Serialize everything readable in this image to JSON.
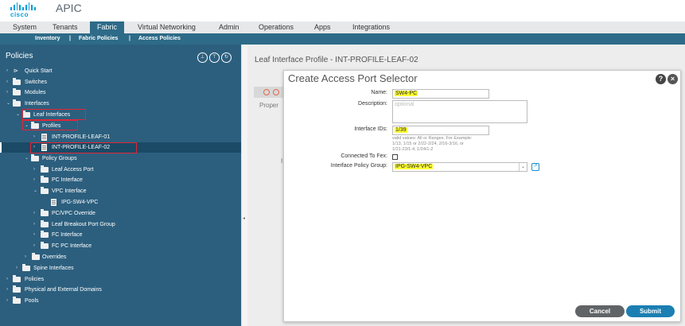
{
  "header": {
    "brand": "cisco",
    "app_title": "APIC"
  },
  "nav": {
    "tabs": [
      "System",
      "Tenants",
      "Fabric",
      "Virtual Networking",
      "Admin",
      "Operations",
      "Apps",
      "Integrations"
    ],
    "active_tab": "Fabric",
    "subtabs": [
      "Inventory",
      "|",
      "Fabric Policies",
      "|",
      "Access Policies"
    ]
  },
  "sidebar": {
    "title": "Policies",
    "tree": [
      {
        "label": "Quick Start"
      },
      {
        "label": "Switches"
      },
      {
        "label": "Modules"
      },
      {
        "label": "Interfaces"
      },
      {
        "label": "Leaf Interfaces"
      },
      {
        "label": "Profiles"
      },
      {
        "label": "INT-PROFILE-LEAF-01"
      },
      {
        "label": "INT-PROFILE-LEAF-02"
      },
      {
        "label": "Policy Groups"
      },
      {
        "label": "Leaf Access Port"
      },
      {
        "label": "PC Interface"
      },
      {
        "label": "VPC Interface"
      },
      {
        "label": "IPG-SW4-VPC"
      },
      {
        "label": "PC/VPC Override"
      },
      {
        "label": "Leaf Breakout Port Group"
      },
      {
        "label": "FC Interface"
      },
      {
        "label": "FC PC Interface"
      },
      {
        "label": "Overrides"
      },
      {
        "label": "Spine Interfaces"
      },
      {
        "label": "Policies"
      },
      {
        "label": "Physical and External Domains"
      },
      {
        "label": "Pools"
      }
    ]
  },
  "main": {
    "title": "Leaf Interface Profile - INT-PROFILE-LEAF-02",
    "ghost_prop": "Proper",
    "ghost_i": "I"
  },
  "dialog": {
    "title": "Create Access Port Selector",
    "help": "?",
    "close": "×",
    "name_label": "Name:",
    "name_value": "SW4-PC",
    "description_label": "Description:",
    "description_placeholder": "optional",
    "interface_ids_label": "Interface IDs:",
    "interface_ids_value": "1/39",
    "hint_line1": "valid values: All or Ranges. For Example:",
    "hint_line2": "1/13, 1/15 or 2/22-2/24, 2/16-3/16, or",
    "hint_line3": "1/21-23/1-4, 1/24/1-2",
    "fex_label": "Connected To Fex:",
    "fex_checked": false,
    "policy_group_label": "Interface Policy Group:",
    "policy_group_value": "IPG-SW4-VPC",
    "cancel_label": "Cancel",
    "submit_label": "Submit"
  },
  "colors": {
    "brand_blue": "#049fd9",
    "nav_active": "#2d6b88",
    "sidebar_bg": "#2c5f7e",
    "highlight": "#ffff33",
    "annotation_red": "#e32636",
    "submit_blue": "#1b7fb2"
  }
}
